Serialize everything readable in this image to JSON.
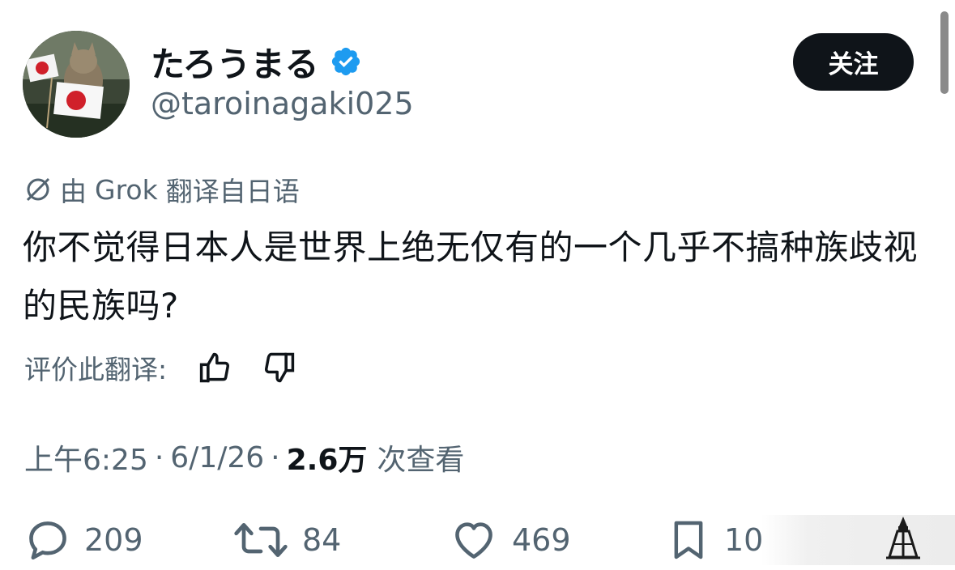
{
  "user": {
    "display_name": "たろうまる",
    "handle": "@taroinagaki025",
    "verified": true
  },
  "follow_button": {
    "label": "关注"
  },
  "translation": {
    "by_prefix": "由",
    "engine": "Grok",
    "suffix": "翻译自日语"
  },
  "tweet": {
    "text": "你不觉得日本人是世界上绝无仅有的一个几乎不搞种族歧视的民族吗?"
  },
  "rate": {
    "label": "评价此翻译:"
  },
  "meta": {
    "time": "上午6:25",
    "date": "6/1/26",
    "views_count": "2.6万",
    "views_label": "次查看",
    "separator": "·"
  },
  "actions": {
    "replies": "209",
    "reposts": "84",
    "likes": "469",
    "bookmarks": "10"
  },
  "colors": {
    "text_primary": "#0f1419",
    "text_secondary": "#536471",
    "verified_blue": "#1d9bf0",
    "button_bg": "#0f1419"
  },
  "icons": {
    "translate": "slashed-circle-icon",
    "verified": "verified-badge-icon",
    "thumbs_up": "thumbs-up-icon",
    "thumbs_down": "thumbs-down-icon",
    "reply": "reply-icon",
    "repost": "repost-icon",
    "like": "heart-icon",
    "bookmark": "bookmark-icon"
  }
}
